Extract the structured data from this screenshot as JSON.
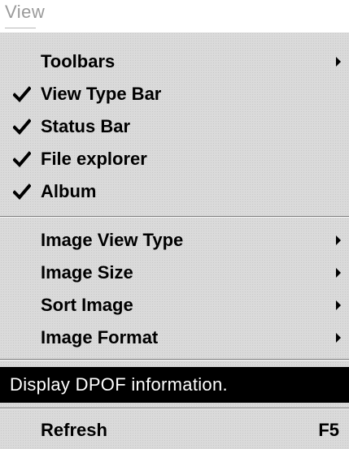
{
  "title": "View",
  "menu": {
    "toolbars": "Toolbars",
    "view_type_bar": "View Type Bar",
    "status_bar": "Status Bar",
    "file_explorer": "File explorer",
    "album": "Album",
    "image_view_type": "Image View Type",
    "image_size": "Image Size",
    "sort_image": "Sort Image",
    "image_format": "Image Format",
    "display_dpof": "Display DPOF information.",
    "refresh": "Refresh",
    "refresh_shortcut": "F5"
  },
  "checked_items": [
    "View Type Bar",
    "Status Bar",
    "File explorer",
    "Album"
  ],
  "icons": {
    "check": "check-icon",
    "submenu": "submenu-arrow-icon"
  },
  "colors": {
    "highlight_background": "#000000",
    "highlight_text": "#ffffff",
    "title": "#9a9a9a"
  }
}
